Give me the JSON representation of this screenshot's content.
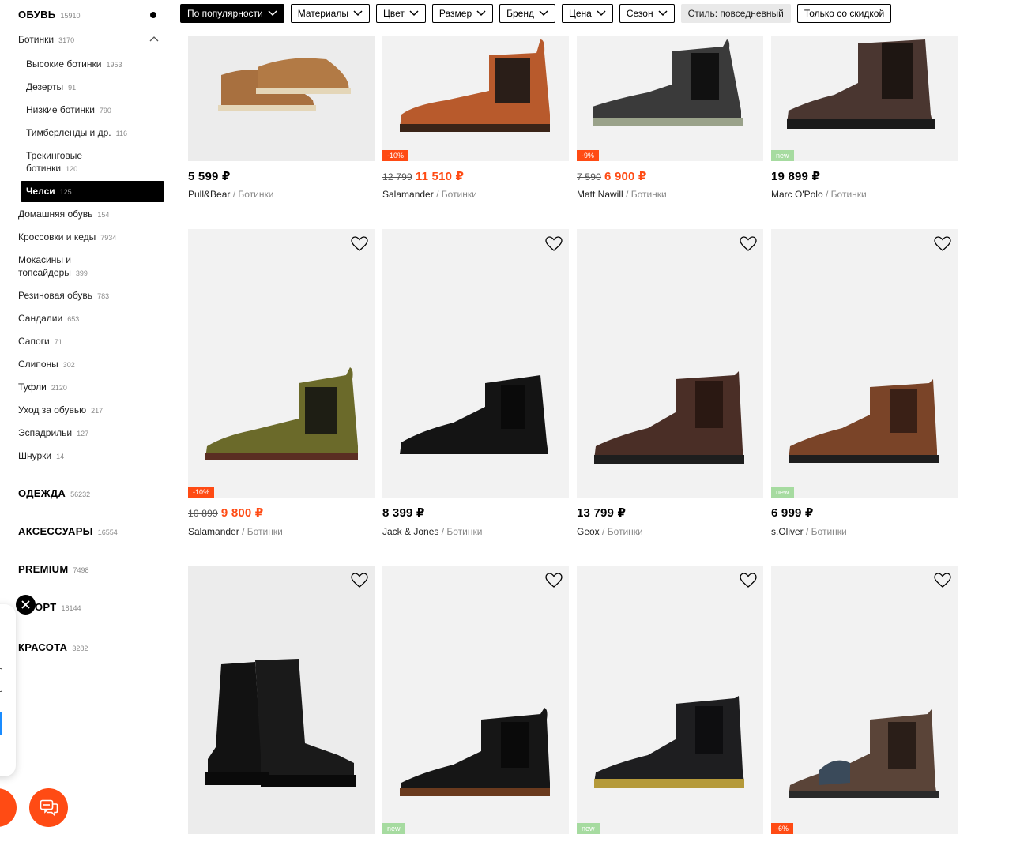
{
  "sidebar": {
    "shoes": {
      "label": "ОБУВЬ",
      "count": "15910"
    },
    "boots": {
      "label": "Ботинки",
      "count": "3170"
    },
    "boot_subs": [
      {
        "label": "Высокие ботинки",
        "count": "1953"
      },
      {
        "label": "Дезерты",
        "count": "91"
      },
      {
        "label": "Низкие ботинки",
        "count": "790"
      },
      {
        "label": "Тимберленды и др.",
        "count": "116"
      },
      {
        "label_line1": "Трекинговые",
        "label_line2": "ботинки",
        "count": "120"
      }
    ],
    "active": {
      "label": "Челси",
      "count": "125"
    },
    "shoe_subs": [
      {
        "label": "Домашняя обувь",
        "count": "154"
      },
      {
        "label": "Кроссовки и кеды",
        "count": "7934"
      },
      {
        "label_line1": "Мокасины и",
        "label_line2": "топсайдеры",
        "count": "399"
      },
      {
        "label": "Резиновая обувь",
        "count": "783"
      },
      {
        "label": "Сандалии",
        "count": "653"
      },
      {
        "label": "Сапоги",
        "count": "71"
      },
      {
        "label": "Слипоны",
        "count": "302"
      },
      {
        "label": "Туфли",
        "count": "2120"
      },
      {
        "label": "Уход за обувью",
        "count": "217"
      },
      {
        "label": "Эспадрильи",
        "count": "127"
      },
      {
        "label": "Шнурки",
        "count": "14"
      }
    ],
    "top": [
      {
        "label": "ОДЕЖДА",
        "count": "56232"
      },
      {
        "label": "АКСЕССУАРЫ",
        "count": "16554"
      },
      {
        "label": "PREMIUM",
        "count": "7498"
      },
      {
        "label": "ОРТ",
        "count": "18144"
      },
      {
        "label": "КРАСОТА",
        "count": "3282"
      }
    ]
  },
  "filters": {
    "sort": "По популярности",
    "materials": "Материалы",
    "color": "Цвет",
    "size": "Размер",
    "brand": "Бренд",
    "price": "Цена",
    "season": "Сезон",
    "style": "Стиль: повседневный",
    "discount": "Только со скидкой"
  },
  "products": [
    {
      "price": "5 599 ₽",
      "old_price": "",
      "badge": "",
      "brand": "Pull&Bear",
      "category": "/ Ботинки"
    },
    {
      "price": "11 510 ₽",
      "old_price": "12 799",
      "badge": "-10%",
      "brand": "Salamander",
      "category": "/ Ботинки"
    },
    {
      "price": "6 900 ₽",
      "old_price": "7 590",
      "badge": "-9%",
      "brand": "Matt Nawill",
      "category": "/ Ботинки"
    },
    {
      "price": "19 899 ₽",
      "old_price": "",
      "badge": "new",
      "brand": "Marc O'Polo",
      "category": "/ Ботинки"
    },
    {
      "price": "9 800 ₽",
      "old_price": "10 899",
      "badge": "-10%",
      "brand": "Salamander",
      "category": "/ Ботинки"
    },
    {
      "price": "8 399 ₽",
      "old_price": "",
      "badge": "",
      "brand": "Jack & Jones",
      "category": "/ Ботинки"
    },
    {
      "price": "13 799 ₽",
      "old_price": "",
      "badge": "",
      "brand": "Geox",
      "category": "/ Ботинки"
    },
    {
      "price": "6 999 ₽",
      "old_price": "",
      "badge": "new",
      "brand": "s.Oliver",
      "category": "/ Ботинки"
    },
    {
      "badge": ""
    },
    {
      "badge": "new"
    },
    {
      "badge": "new"
    },
    {
      "badge": "-6%"
    }
  ],
  "colors": {
    "accent": "#ff4b14",
    "new_badge": "#a6dba0",
    "image_bg": "#f2f2f2"
  }
}
